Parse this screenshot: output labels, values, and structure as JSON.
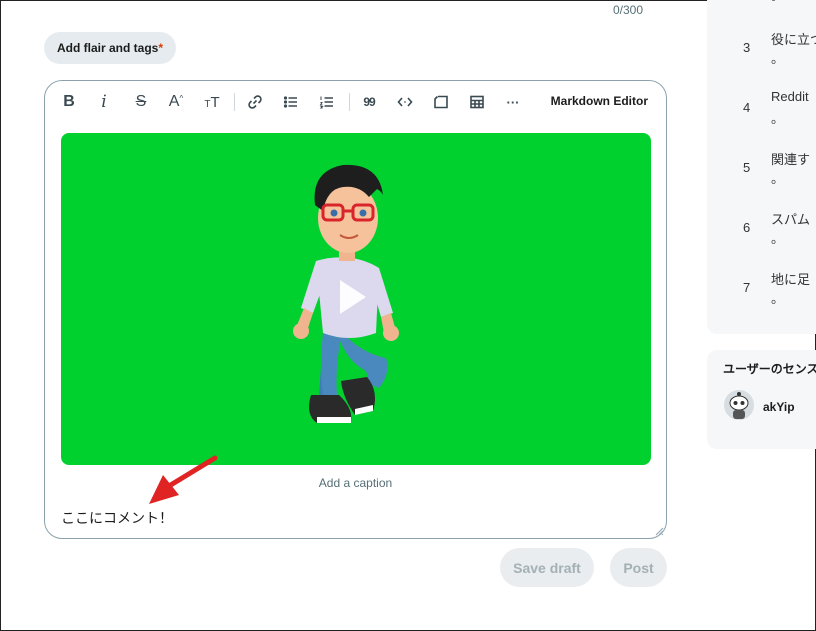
{
  "title_counter": "0/300",
  "flair": {
    "label": "Add flair and tags",
    "required_mark": "*"
  },
  "toolbar": {
    "bold": "B",
    "italic": "i",
    "strike": "S",
    "superscript": "A",
    "heading": "T",
    "quote": "99",
    "more": "···",
    "markdown_editor": "Markdown Editor"
  },
  "media": {
    "caption_placeholder": "Add a caption",
    "background": "#00d12f"
  },
  "comment_text": "ここにコメント！",
  "actions": {
    "save_draft": "Save draft",
    "post": "Post"
  },
  "rules": {
    "items": [
      {
        "num": "3",
        "text": "役に立つ"
      },
      {
        "num": "4",
        "text": "Reddit"
      },
      {
        "num": "5",
        "text": "関連す"
      },
      {
        "num": "6",
        "text": "スパム"
      },
      {
        "num": "7",
        "text": "地に足"
      }
    ],
    "trailing": "。"
  },
  "users_widget": {
    "title": "ユーザーのセンス",
    "user": "akYip"
  }
}
